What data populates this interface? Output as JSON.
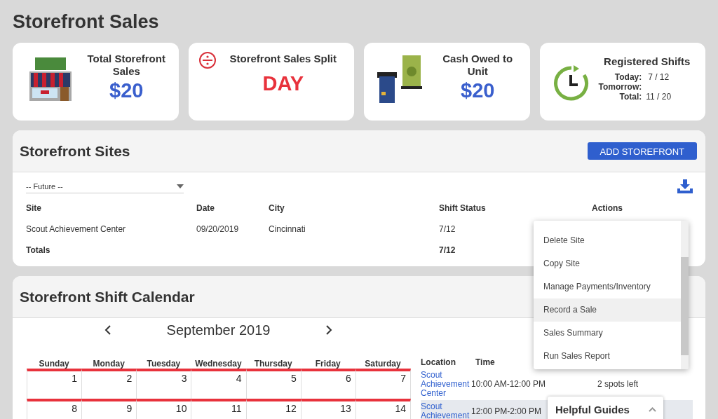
{
  "page_title": "Storefront Sales",
  "stat_cards": [
    {
      "kind": "sales",
      "title": "Total Storefront Sales",
      "value": "$20"
    },
    {
      "kind": "split",
      "title": "Storefront Sales Split",
      "value": "DAY"
    },
    {
      "kind": "cash",
      "title": "Cash Owed to Unit",
      "value": "$20"
    },
    {
      "kind": "shifts",
      "title": "Registered Shifts",
      "lines": [
        {
          "label": "Today:",
          "value": "7 / 12"
        },
        {
          "label": "Tomorrow:"
        },
        {
          "label": "Total:",
          "value": "11 / 20"
        }
      ]
    }
  ],
  "sites": {
    "title": "Storefront Sites",
    "add_button": "ADD STOREFRONT",
    "filter": "-- Future --",
    "columns": [
      "Site",
      "Date",
      "City",
      "Shift Status",
      "Actions"
    ],
    "rows": [
      {
        "cells": [
          "Scout Achievement Center",
          "09/20/2019",
          "Cincinnati",
          "7/12"
        ]
      }
    ],
    "totals": {
      "label": "Totals",
      "shift_status": "7/12"
    }
  },
  "actions_menu": [
    {
      "label": "Delete Site",
      "selected": false
    },
    {
      "label": "Copy Site",
      "selected": false
    },
    {
      "label": "Manage Payments/Inventory",
      "selected": false
    },
    {
      "label": "Record a Sale",
      "selected": true
    },
    {
      "label": "Sales Summary",
      "selected": false
    },
    {
      "label": "Run Sales Report",
      "selected": false
    }
  ],
  "calendar": {
    "title": "Storefront Shift Calendar",
    "month": "September 2019",
    "weekdays": [
      "Sunday",
      "Monday",
      "Tuesday",
      "Wednesday",
      "Thursday",
      "Friday",
      "Saturday"
    ],
    "weeks": [
      [
        "1",
        "2",
        "3",
        "4",
        "5",
        "6",
        "7"
      ],
      [
        "8",
        "9",
        "10",
        "11",
        "12",
        "13",
        "14"
      ]
    ],
    "shift_columns": [
      "Location",
      "Time"
    ],
    "shifts": [
      {
        "location": "Scout Achievement Center",
        "time": "10:00 AM-12:00 PM",
        "spots": "2 spots left",
        "highlighted": false
      },
      {
        "location": "Scout Achievement",
        "time": "12:00 PM-2:00 PM",
        "highlighted": true
      }
    ]
  },
  "helpful_guides": {
    "title": "Helpful Guides"
  }
}
